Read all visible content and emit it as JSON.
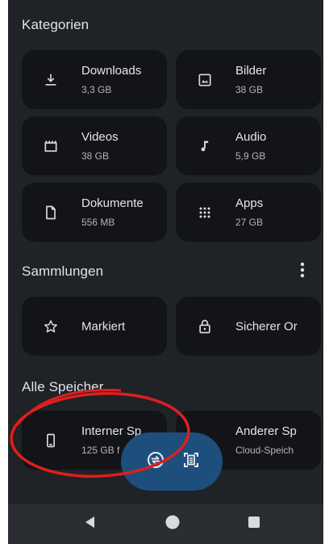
{
  "sections": {
    "categories_title": "Kategorien",
    "collections_title": "Sammlungen",
    "storage_title": "Alle Speicher"
  },
  "categories": [
    {
      "label": "Downloads",
      "sub": "3,3 GB",
      "icon": "download-icon"
    },
    {
      "label": "Bilder",
      "sub": "38 GB",
      "icon": "image-icon"
    },
    {
      "label": "Videos",
      "sub": "38 GB",
      "icon": "movie-icon"
    },
    {
      "label": "Audio",
      "sub": "5,9 GB",
      "icon": "music-note-icon"
    },
    {
      "label": "Dokumente",
      "sub": "556 MB",
      "icon": "document-icon"
    },
    {
      "label": "Apps",
      "sub": "27 GB",
      "icon": "apps-grid-icon"
    }
  ],
  "collections": [
    {
      "label": "Markiert",
      "icon": "star-icon"
    },
    {
      "label": "Sicherer Or",
      "icon": "lock-icon"
    }
  ],
  "storage": [
    {
      "label": "Interner Sp",
      "sub": "125 GB f",
      "icon": "phone-icon"
    },
    {
      "label": "Anderer Sp",
      "sub": "Cloud-Speich",
      "icon": "cloud-storage-icon"
    }
  ],
  "fab": {
    "left_icon": "transfer-icon",
    "right_icon": "document-scan-icon"
  },
  "navbar": {
    "back_icon": "back-triangle-icon",
    "home_icon": "home-circle-icon",
    "recents_icon": "recents-square-icon"
  },
  "colors": {
    "background": "#1f2226",
    "card": "#121417",
    "fab": "#1e4f7c",
    "annotation": "#e01e1e"
  }
}
